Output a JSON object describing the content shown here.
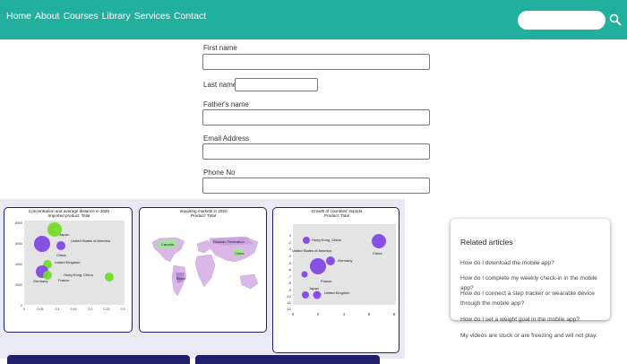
{
  "nav": {
    "links": [
      "Home",
      "About",
      "Courses",
      "Library",
      "Services",
      "Contact"
    ],
    "search_placeholder": ""
  },
  "form": {
    "first_name": {
      "label": "First name",
      "value": ""
    },
    "last_name": {
      "label": "Last name",
      "value": ""
    },
    "fathers_name": {
      "label": "Father's name",
      "value": ""
    },
    "email": {
      "label": "Email Address",
      "value": ""
    },
    "phone": {
      "label": "Phone No",
      "value": ""
    }
  },
  "charts": {
    "concentration": {
      "title_line1": "Concentration and average distance in 2020",
      "title_line2": "Imported product: Total",
      "y_ticks": [
        "8000",
        "6000",
        "4000",
        "2000",
        "0"
      ],
      "x_ticks": [
        "0",
        "0.05",
        "0.1",
        "0.15",
        "0.2",
        "0.25",
        "0.3"
      ],
      "labels": [
        "Japan",
        "United States of America",
        "China",
        "United Kingdom",
        "Germany",
        "Hong Kong, China",
        "France"
      ]
    },
    "importing_markets": {
      "title_line1": "Importing markets in 2020",
      "title_line2": "Product: Total",
      "labels": [
        "Canada",
        "Russian Federation",
        "China",
        "Brazil"
      ]
    },
    "growth": {
      "title_line1": "Growth of countries' imports",
      "title_line2": "Product: Total",
      "y_ticks": [
        "0",
        "-2",
        "-3",
        "-4",
        "-5",
        "-6",
        "-7",
        "-8",
        "-9",
        "-10",
        "-11",
        "-12",
        "-13",
        "-14"
      ],
      "x_ticks": [
        "0",
        "2",
        "4",
        "6",
        "8"
      ],
      "labels": [
        "Hong Kong, China",
        "United States of America",
        "China",
        "Germany",
        "France",
        "Japan",
        "United Kingdom"
      ]
    }
  },
  "related": {
    "title": "Related articles",
    "links": [
      "How do I download the mobile app?",
      "How do I complete my weekly check-in in the mobile app?",
      "How do I connect a step tracker or wearable device through the mobile app?",
      "How do I set a weight goal in the mobile app?",
      "My videos are stuck or are freezing and will not play."
    ]
  },
  "colors": {
    "navbar": "#22b09e",
    "card_border": "#1e1e6a",
    "bubble_purple": "#7b3fe4",
    "bubble_green": "#6ddc1f",
    "map_land": "#d9b8e8"
  }
}
